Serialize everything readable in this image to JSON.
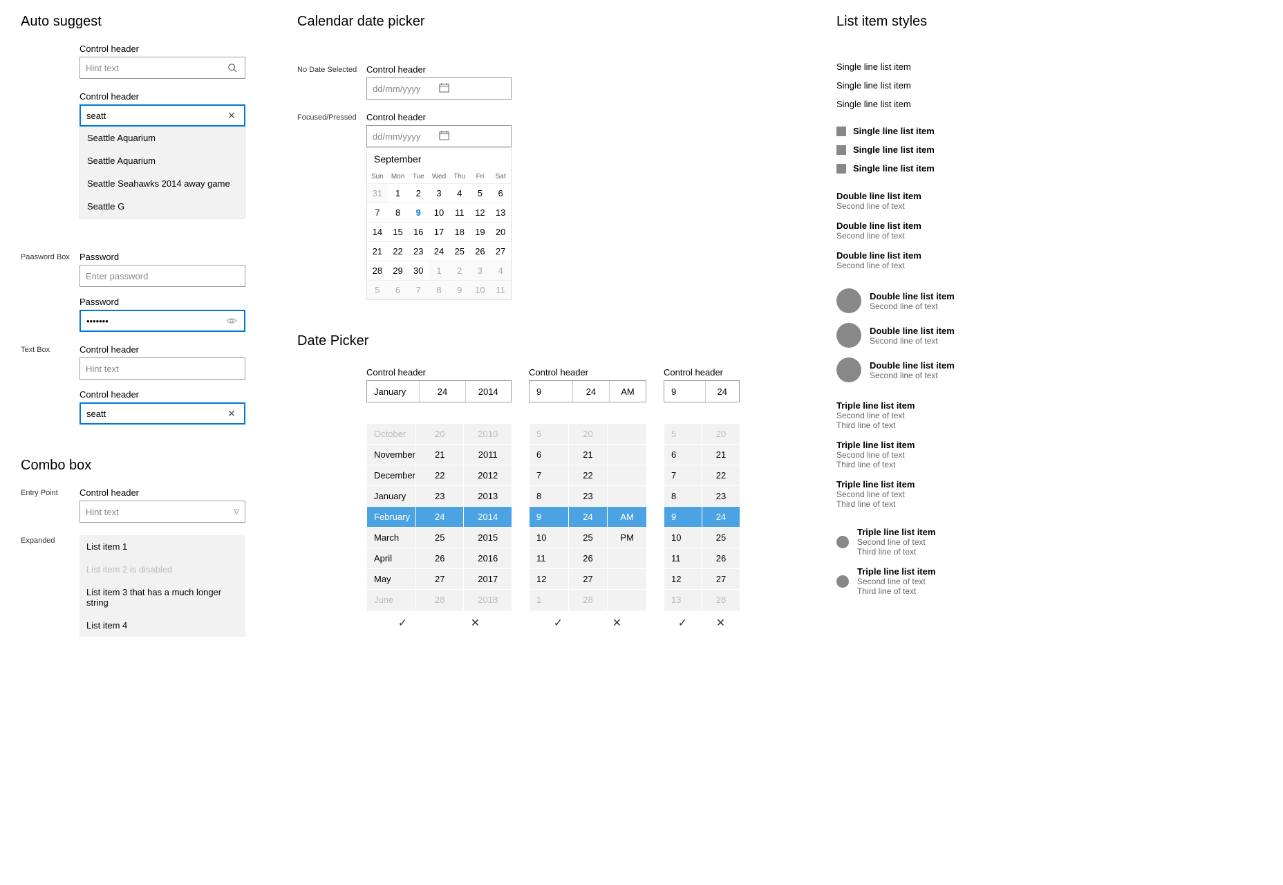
{
  "autosuggest": {
    "title": "Auto suggest",
    "field1": {
      "header": "Control header",
      "placeholder": "Hint text"
    },
    "field2": {
      "header": "Control header",
      "value": "seatt"
    },
    "suggestions": [
      "Seattle Aquarium",
      "Seattle Aquarium",
      "Seattle Seahawks 2014 away game",
      "Seattle G"
    ]
  },
  "password": {
    "label": "Paasword Box",
    "field1": {
      "header": "Password",
      "placeholder": "Enter password"
    },
    "field2": {
      "header": "Password",
      "value": "•••••••"
    }
  },
  "textbox": {
    "label": "Text Box",
    "field1": {
      "header": "Control header",
      "placeholder": "Hint text"
    },
    "field2": {
      "header": "Control header",
      "value": "seatt"
    }
  },
  "combo": {
    "title": "Combo box",
    "entry_label": "Entry Point",
    "expanded_label": "Expanded",
    "field": {
      "header": "Control header",
      "placeholder": "Hint text"
    },
    "items": [
      "List item 1",
      "List item 2 is disabled",
      "List item 3 that has a much longer string",
      "List item 4"
    ]
  },
  "caldate": {
    "title": "Calendar date picker",
    "label_nodate": "No Date Selected",
    "label_focused": "Focused/Pressed",
    "header": "Control header",
    "placeholder": "dd/mm/yyyy",
    "month": "September",
    "dow": [
      "Sun",
      "Mon",
      "Tue",
      "Wed",
      "Thu",
      "Fri",
      "Sat"
    ],
    "grid": [
      {
        "d": "31",
        "o": true
      },
      {
        "d": "1"
      },
      {
        "d": "2"
      },
      {
        "d": "3"
      },
      {
        "d": "4"
      },
      {
        "d": "5"
      },
      {
        "d": "6"
      },
      {
        "d": "7"
      },
      {
        "d": "8"
      },
      {
        "d": "9",
        "t": true
      },
      {
        "d": "10"
      },
      {
        "d": "11"
      },
      {
        "d": "12"
      },
      {
        "d": "13"
      },
      {
        "d": "14"
      },
      {
        "d": "15"
      },
      {
        "d": "16"
      },
      {
        "d": "17"
      },
      {
        "d": "18"
      },
      {
        "d": "19"
      },
      {
        "d": "20"
      },
      {
        "d": "21"
      },
      {
        "d": "22"
      },
      {
        "d": "23"
      },
      {
        "d": "24"
      },
      {
        "d": "25"
      },
      {
        "d": "26"
      },
      {
        "d": "27"
      },
      {
        "d": "28"
      },
      {
        "d": "29"
      },
      {
        "d": "30"
      },
      {
        "d": "1",
        "o": true
      },
      {
        "d": "2",
        "o": true
      },
      {
        "d": "3",
        "o": true
      },
      {
        "d": "4",
        "o": true
      },
      {
        "d": "5",
        "o": true
      },
      {
        "d": "6",
        "o": true
      },
      {
        "d": "7",
        "o": true
      },
      {
        "d": "8",
        "o": true
      },
      {
        "d": "9",
        "o": true
      },
      {
        "d": "10",
        "o": true
      },
      {
        "d": "11",
        "o": true
      }
    ]
  },
  "datepicker": {
    "title": "Date Picker",
    "header": "Control header",
    "p1": {
      "cols": [
        "January",
        "24",
        "2014"
      ]
    },
    "p2": {
      "cols": [
        "9",
        "24",
        "AM"
      ]
    },
    "p3": {
      "cols": [
        "9",
        "24"
      ]
    },
    "spin1": {
      "cols": [
        [
          {
            "v": "October",
            "dim": true
          },
          {
            "v": "November"
          },
          {
            "v": "December"
          },
          {
            "v": "January"
          },
          {
            "v": "February",
            "sel": true
          },
          {
            "v": "March"
          },
          {
            "v": "April"
          },
          {
            "v": "May"
          },
          {
            "v": "June",
            "dim": true
          }
        ],
        [
          {
            "v": "20",
            "dim": true
          },
          {
            "v": "21"
          },
          {
            "v": "22"
          },
          {
            "v": "23"
          },
          {
            "v": "24",
            "sel": true
          },
          {
            "v": "25"
          },
          {
            "v": "26"
          },
          {
            "v": "27"
          },
          {
            "v": "28",
            "dim": true
          }
        ],
        [
          {
            "v": "2010",
            "dim": true
          },
          {
            "v": "2011"
          },
          {
            "v": "2012"
          },
          {
            "v": "2013"
          },
          {
            "v": "2014",
            "sel": true
          },
          {
            "v": "2015"
          },
          {
            "v": "2016"
          },
          {
            "v": "2017"
          },
          {
            "v": "2018",
            "dim": true
          }
        ]
      ]
    },
    "spin2": {
      "cols": [
        [
          {
            "v": "5",
            "dim": true
          },
          {
            "v": "6"
          },
          {
            "v": "7"
          },
          {
            "v": "8"
          },
          {
            "v": "9",
            "sel": true
          },
          {
            "v": "10"
          },
          {
            "v": "11"
          },
          {
            "v": "12"
          },
          {
            "v": "1",
            "dim": true
          }
        ],
        [
          {
            "v": "20",
            "dim": true
          },
          {
            "v": "21"
          },
          {
            "v": "22"
          },
          {
            "v": "23"
          },
          {
            "v": "24",
            "sel": true
          },
          {
            "v": "25"
          },
          {
            "v": "26"
          },
          {
            "v": "27"
          },
          {
            "v": "28",
            "dim": true
          }
        ],
        [
          {
            "v": ""
          },
          {
            "v": ""
          },
          {
            "v": ""
          },
          {
            "v": ""
          },
          {
            "v": "AM",
            "sel": true
          },
          {
            "v": "PM"
          },
          {
            "v": ""
          },
          {
            "v": ""
          },
          {
            "v": ""
          }
        ]
      ]
    },
    "spin3": {
      "cols": [
        [
          {
            "v": "5",
            "dim": true
          },
          {
            "v": "6"
          },
          {
            "v": "7"
          },
          {
            "v": "8"
          },
          {
            "v": "9",
            "sel": true
          },
          {
            "v": "10"
          },
          {
            "v": "11"
          },
          {
            "v": "12"
          },
          {
            "v": "13",
            "dim": true
          }
        ],
        [
          {
            "v": "20",
            "dim": true
          },
          {
            "v": "21"
          },
          {
            "v": "22"
          },
          {
            "v": "23"
          },
          {
            "v": "24",
            "sel": true
          },
          {
            "v": "25"
          },
          {
            "v": "26"
          },
          {
            "v": "27"
          },
          {
            "v": "28",
            "dim": true
          }
        ]
      ]
    }
  },
  "list": {
    "title": "List item styles",
    "single": [
      "Single line list item",
      "Single line list item",
      "Single line list item"
    ],
    "single_bold": [
      "Single line list item",
      "Single line list item",
      "Single line list item"
    ],
    "double": [
      {
        "t1": "Double line list item",
        "t2": "Second line of text"
      },
      {
        "t1": "Double line list item",
        "t2": "Second line of text"
      },
      {
        "t1": "Double line list item",
        "t2": "Second line of text"
      }
    ],
    "double_av": [
      {
        "t1": "Double line list item",
        "t2": "Second line of text"
      },
      {
        "t1": "Double line list item",
        "t2": "Second line of text"
      },
      {
        "t1": "Double line list item",
        "t2": "Second line of text"
      }
    ],
    "triple": [
      {
        "t1": "Triple line list item",
        "t2": "Second line of text",
        "t3": "Third line of text"
      },
      {
        "t1": "Triple line list item",
        "t2": "Second line of text",
        "t3": "Third line of text"
      },
      {
        "t1": "Triple line list item",
        "t2": "Second line of text",
        "t3": "Third line of text"
      }
    ],
    "triple_av": [
      {
        "t1": "Triple line list item",
        "t2": "Second line of text",
        "t3": "Third line of text"
      },
      {
        "t1": "Triple line list item",
        "t2": "Second line of text",
        "t3": "Third line of text"
      }
    ]
  }
}
